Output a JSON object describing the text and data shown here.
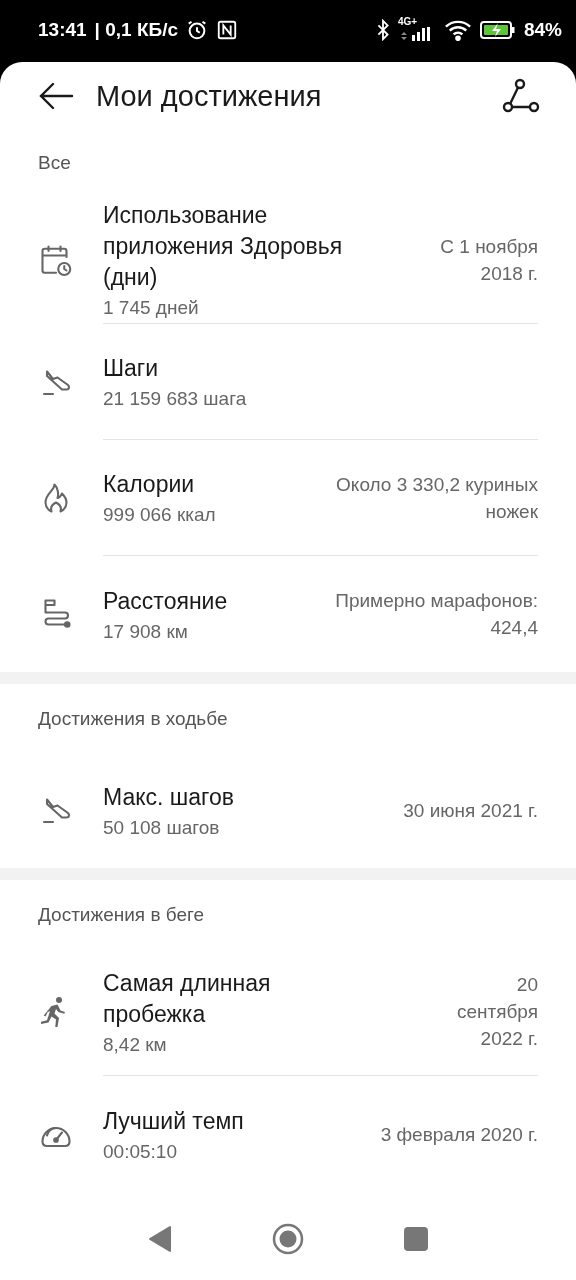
{
  "status_bar": {
    "time": "13:41",
    "speed": "| 0,1 КБ/с",
    "network": "4G+",
    "battery": "84%"
  },
  "header": {
    "title": "Мои достижения"
  },
  "sections": [
    {
      "label": "Все",
      "items": [
        {
          "kind": "calendar",
          "title": [
            "Использование",
            "приложения Здоровья",
            "(дни)"
          ],
          "value": "1 745 дней",
          "note": [
            "С 1 ноября",
            "2018 г."
          ]
        },
        {
          "kind": "shoe",
          "title": [
            "Шаги"
          ],
          "value": "21 159 683 шага"
        },
        {
          "kind": "flame",
          "title": [
            "Калории"
          ],
          "value": "999 066 ккал",
          "note": [
            "Около 3 330,2 куриных",
            "ножек"
          ]
        },
        {
          "kind": "route",
          "title": [
            "Расстояние"
          ],
          "value": "17 908 км",
          "note": [
            "Примерно марафонов:",
            "424,4"
          ]
        }
      ]
    },
    {
      "label": "Достижения в ходьбе",
      "items": [
        {
          "kind": "shoe",
          "title": [
            "Макс. шагов"
          ],
          "value": "50 108 шагов",
          "note": [
            "30 июня 2021 г."
          ]
        }
      ]
    },
    {
      "label": "Достижения в беге",
      "items": [
        {
          "kind": "runner",
          "title": [
            "Самая длинная",
            "пробежка"
          ],
          "value": "8,42 км",
          "note": [
            "20",
            "сентября",
            "2022 г."
          ]
        },
        {
          "kind": "gauge",
          "title": [
            "Лучший темп"
          ],
          "value": "00:05:10",
          "note": [
            "3 февраля 2020 г."
          ]
        }
      ]
    }
  ]
}
